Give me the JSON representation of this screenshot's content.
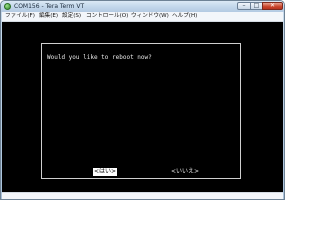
{
  "window": {
    "title": "COM156 - Tera Term VT",
    "app_icon": "tera-term-icon",
    "controls": {
      "minimize_icon": "minimize-icon",
      "minimize_glyph": "–",
      "maximize_icon": "maximize-icon",
      "maximize_glyph": "□",
      "close_icon": "close-icon",
      "close_glyph": "✕"
    }
  },
  "menubar": {
    "items": [
      "ファイル(F)",
      "編集(E)",
      "設定(S)",
      "コントロール(O)",
      "ウィンドウ(W)",
      "ヘルプ(H)"
    ]
  },
  "dialog": {
    "prompt": "Would you like to reboot now?",
    "yes_label": "<はい>",
    "no_label": "<いいえ>"
  },
  "colors": {
    "terminal_background": "#000000",
    "terminal_text": "#e8e8e8",
    "selected_background": "#ffffff",
    "selected_text": "#000000",
    "close_button": "#c8442a"
  }
}
